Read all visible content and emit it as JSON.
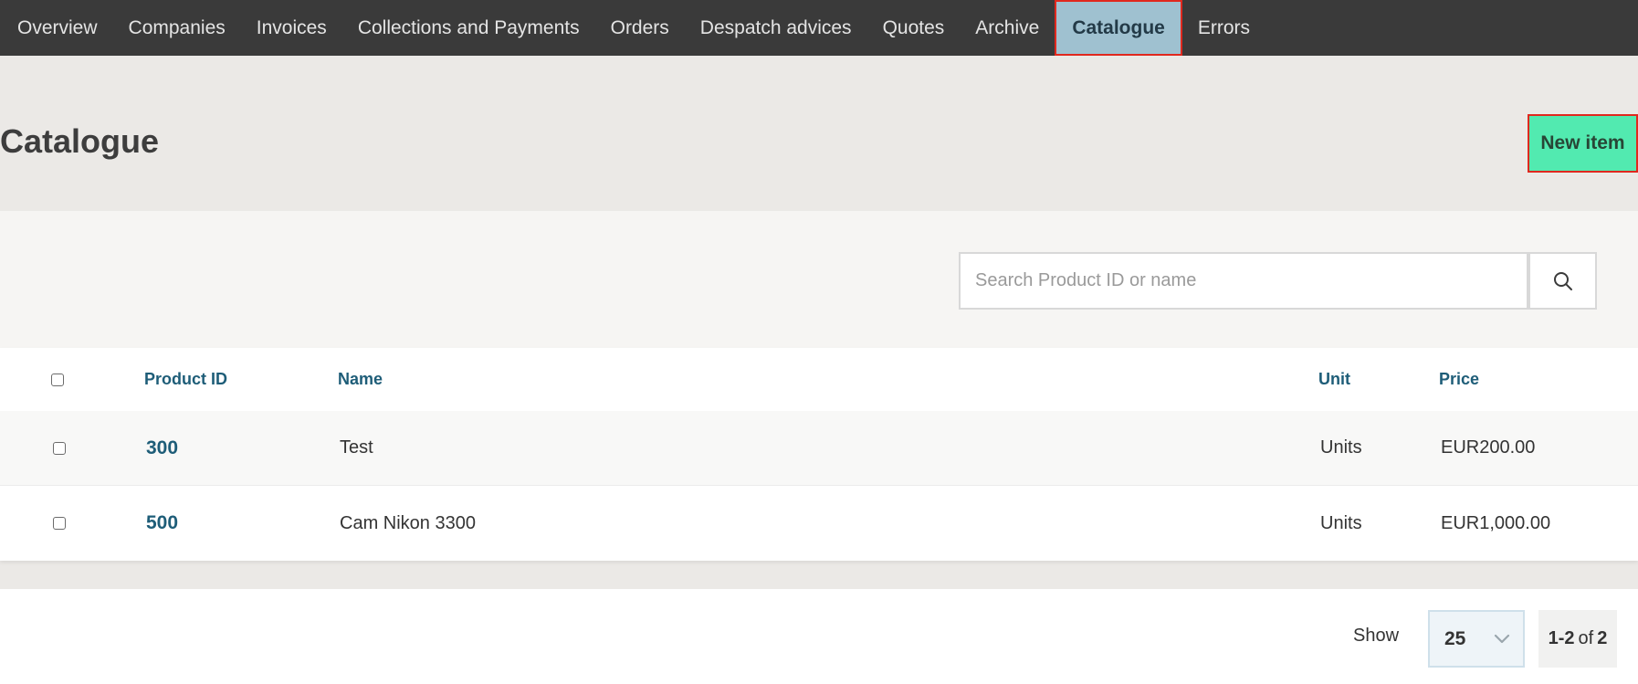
{
  "nav": {
    "items": [
      {
        "label": "Overview"
      },
      {
        "label": "Companies"
      },
      {
        "label": "Invoices"
      },
      {
        "label": "Collections and Payments"
      },
      {
        "label": "Orders"
      },
      {
        "label": "Despatch advices"
      },
      {
        "label": "Quotes"
      },
      {
        "label": "Archive"
      },
      {
        "label": "Catalogue",
        "active": true
      },
      {
        "label": "Errors"
      }
    ]
  },
  "page": {
    "title": "Catalogue",
    "new_item_label": "New item"
  },
  "search": {
    "placeholder": "Search Product ID or name",
    "value": "",
    "icon": "search-icon"
  },
  "table": {
    "columns": [
      "Product ID",
      "Name",
      "Unit",
      "Price"
    ],
    "rows": [
      {
        "product_id": "300",
        "name": "Test",
        "unit": "Units",
        "price": "EUR200.00"
      },
      {
        "product_id": "500",
        "name": "Cam Nikon 3300",
        "unit": "Units",
        "price": "EUR1,000.00"
      }
    ]
  },
  "pagination": {
    "show_label": "Show",
    "page_size": "25",
    "range_start": "1-2",
    "range_of": "of",
    "range_total": "2"
  },
  "colors": {
    "nav_bg": "#3a3a3a",
    "nav_active_bg": "#9fc1d0",
    "accent_button": "#52eab0",
    "highlight_border": "#e0281e",
    "link": "#1e5d78"
  }
}
